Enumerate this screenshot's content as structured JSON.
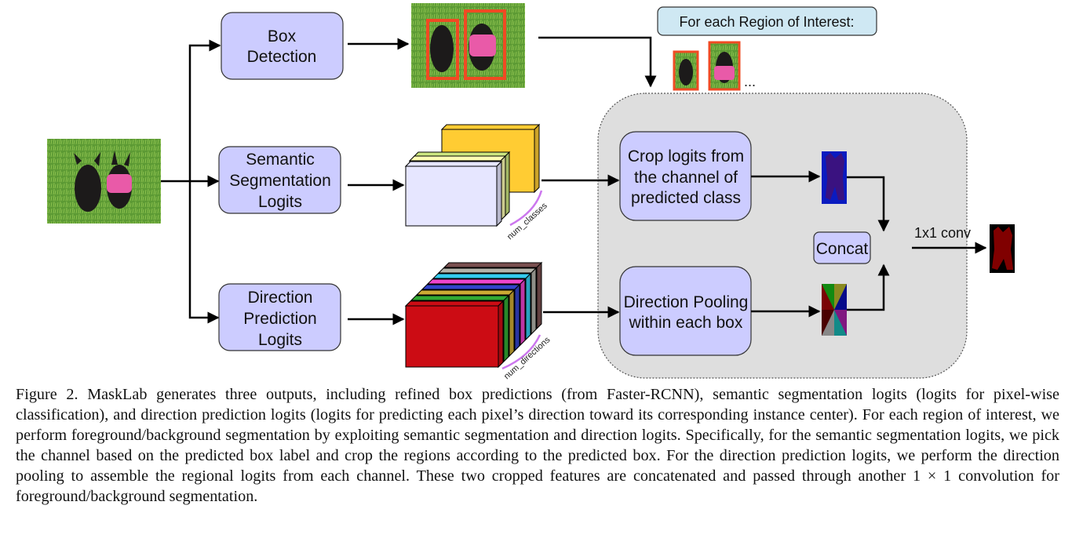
{
  "diagram": {
    "blocks": {
      "box_detection": [
        "Box",
        "Detection"
      ],
      "semantic_segmentation": [
        "Semantic",
        "Segmentation",
        "Logits"
      ],
      "direction_prediction": [
        "Direction",
        "Prediction",
        "Logits"
      ],
      "crop_logits": [
        "Crop logits from",
        "the channel of",
        "predicted class"
      ],
      "direction_pooling": [
        "Direction Pooling",
        "within each box"
      ],
      "concat": "Concat"
    },
    "roi_label": "For each Region of Interest:",
    "ellipsis": "...",
    "conv_label": "1x1 conv",
    "num_classes_label": "num_classes",
    "num_directions_label": "num_directions",
    "images": {
      "input": "input-image-two-dogs",
      "detections": "image-with-box-detections",
      "roi_crops": [
        "roi-crop-dog-1",
        "roi-crop-dog-2"
      ],
      "cropped_semantic": "cropped-semantic-logits",
      "pooled_direction": "pooled-direction-logits",
      "output_mask": "output-instance-mask"
    },
    "colors": {
      "block_fill": "#ccccff",
      "roi_label_fill": "#cfe8f3",
      "region_fill": "#dedede",
      "box_highlight": "#f04a23",
      "bracket": "#cc77ee",
      "semantic_channels": [
        "#ffcc33",
        "#cce680",
        "#ffffb3",
        "#e6e6ff"
      ],
      "direction_channels": [
        "#7a5050",
        "#b3b3aa",
        "#33ccf0",
        "#ee44cc",
        "#3344cc",
        "#ccaa33",
        "#33aa33",
        "#cc0c14"
      ],
      "mask_foreground": "#800000"
    }
  },
  "caption": "Figure 2. MaskLab generates three outputs, including refined box predictions (from Faster-RCNN), semantic segmentation logits (logits for pixel-wise classification), and direction prediction logits (logits for predicting each pixel’s direction toward its corresponding instance center). For each region of interest, we perform foreground/background segmentation by exploiting semantic segmentation and direction logits. Specifically, for the semantic segmentation logits, we pick the channel based on the predicted box label and crop the regions according to the predicted box. For the direction prediction logits, we perform the direction pooling to assemble the regional logits from each channel. These two cropped features are concatenated and passed through another 1 × 1 convolution for foreground/background segmentation."
}
